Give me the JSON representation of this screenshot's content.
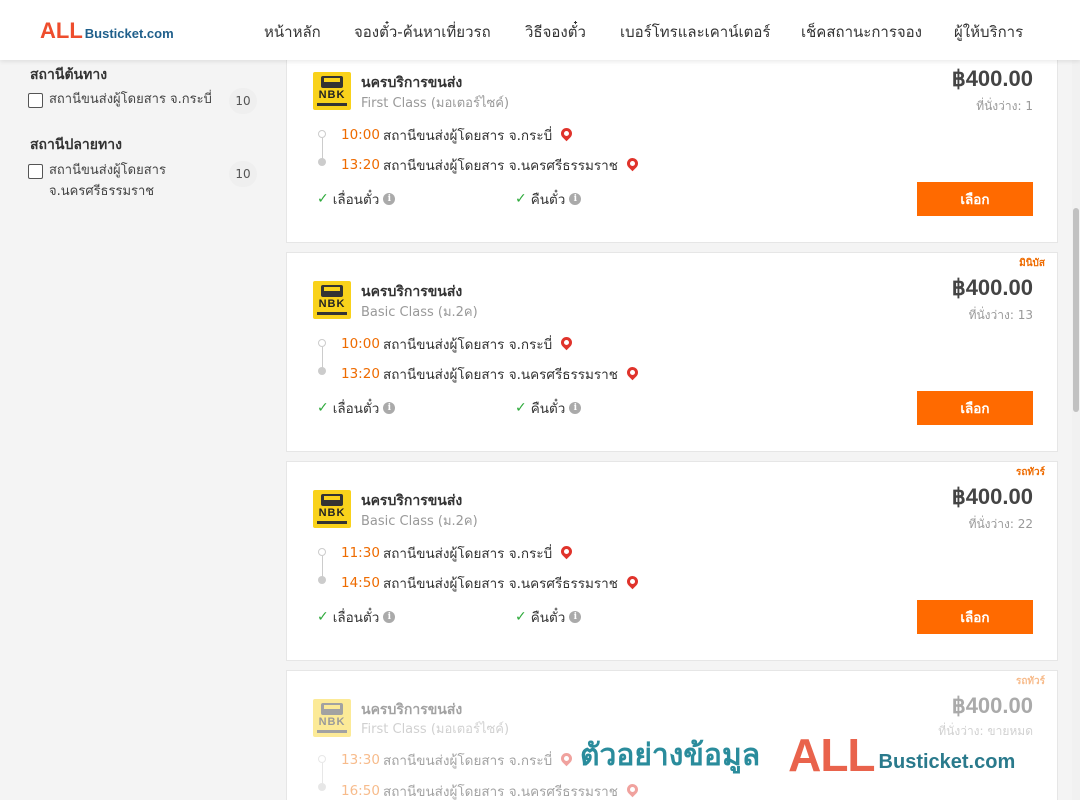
{
  "brand": {
    "logo_main": "ALL",
    "logo_sub": "Busticket.com"
  },
  "nav": [
    "หน้าหลัก",
    "จองตั๋ว-ค้นหาเที่ยวรถ",
    "วิธีจองตั๋ว",
    "เบอร์โทรและเคาน์เตอร์",
    "เช็คสถานะการจอง",
    "ผู้ให้บริการ"
  ],
  "sidebar": {
    "origin": {
      "title": "สถานีต้นทาง",
      "option": "สถานีขนส่งผู้โดยสาร จ.กระบี่",
      "count": "10"
    },
    "destination": {
      "title": "สถานีปลายทาง",
      "option": "สถานีขนส่งผู้โดยสาร จ.นครศรีธรรมราช",
      "count": "10"
    }
  },
  "trips": [
    {
      "tag": "",
      "operator": "นครบริการขนส่ง",
      "class": "First Class (มอเตอร์ไซค์)",
      "price": "฿400.00",
      "seats": "ที่นั่งว่าง: 1",
      "dep_time": "10:00",
      "dep_station": "สถานีขนส่งผู้โดยสาร จ.กระบี่",
      "arr_time": "13:20",
      "arr_station": "สถานีขนส่งผู้โดยสาร จ.นครศรีธรรมราช",
      "feature_1": "เลื่อนตั๋ว",
      "feature_2": "คืนตั๋ว",
      "button": "เลือก"
    },
    {
      "tag": "มินิบัส",
      "operator": "นครบริการขนส่ง",
      "class": "Basic Class (ม.2ค)",
      "price": "฿400.00",
      "seats": "ที่นั่งว่าง: 13",
      "dep_time": "10:00",
      "dep_station": "สถานีขนส่งผู้โดยสาร จ.กระบี่",
      "arr_time": "13:20",
      "arr_station": "สถานีขนส่งผู้โดยสาร จ.นครศรีธรรมราช",
      "feature_1": "เลื่อนตั๋ว",
      "feature_2": "คืนตั๋ว",
      "button": "เลือก"
    },
    {
      "tag": "รถทัวร์",
      "operator": "นครบริการขนส่ง",
      "class": "Basic Class (ม.2ค)",
      "price": "฿400.00",
      "seats": "ที่นั่งว่าง: 22",
      "dep_time": "11:30",
      "dep_station": "สถานีขนส่งผู้โดยสาร จ.กระบี่",
      "arr_time": "14:50",
      "arr_station": "สถานีขนส่งผู้โดยสาร จ.นครศรีธรรมราช",
      "feature_1": "เลื่อนตั๋ว",
      "feature_2": "คืนตั๋ว",
      "button": "เลือก"
    },
    {
      "tag": "รถทัวร์",
      "operator": "นครบริการขนส่ง",
      "class": "First Class (มอเตอร์ไซค์)",
      "price": "฿400.00",
      "seats": "ที่นั่งว่าง: ขายหมด",
      "dep_time": "13:30",
      "dep_station": "สถานีขนส่งผู้โดยสาร จ.กระบี่",
      "arr_time": "16:50",
      "arr_station": "สถานีขนส่งผู้โดยสาร จ.นครศรีธรรมราช"
    }
  ],
  "operator_logo_text": "NBK",
  "watermark": {
    "thai": "ตัวอย่างข้อมูล",
    "all": "ALL",
    "bus": "Busticket.com"
  },
  "colors": {
    "accent": "#ff6a00",
    "time": "#ee6b00",
    "pin": "#e0332b",
    "check": "#2eaa3c"
  }
}
